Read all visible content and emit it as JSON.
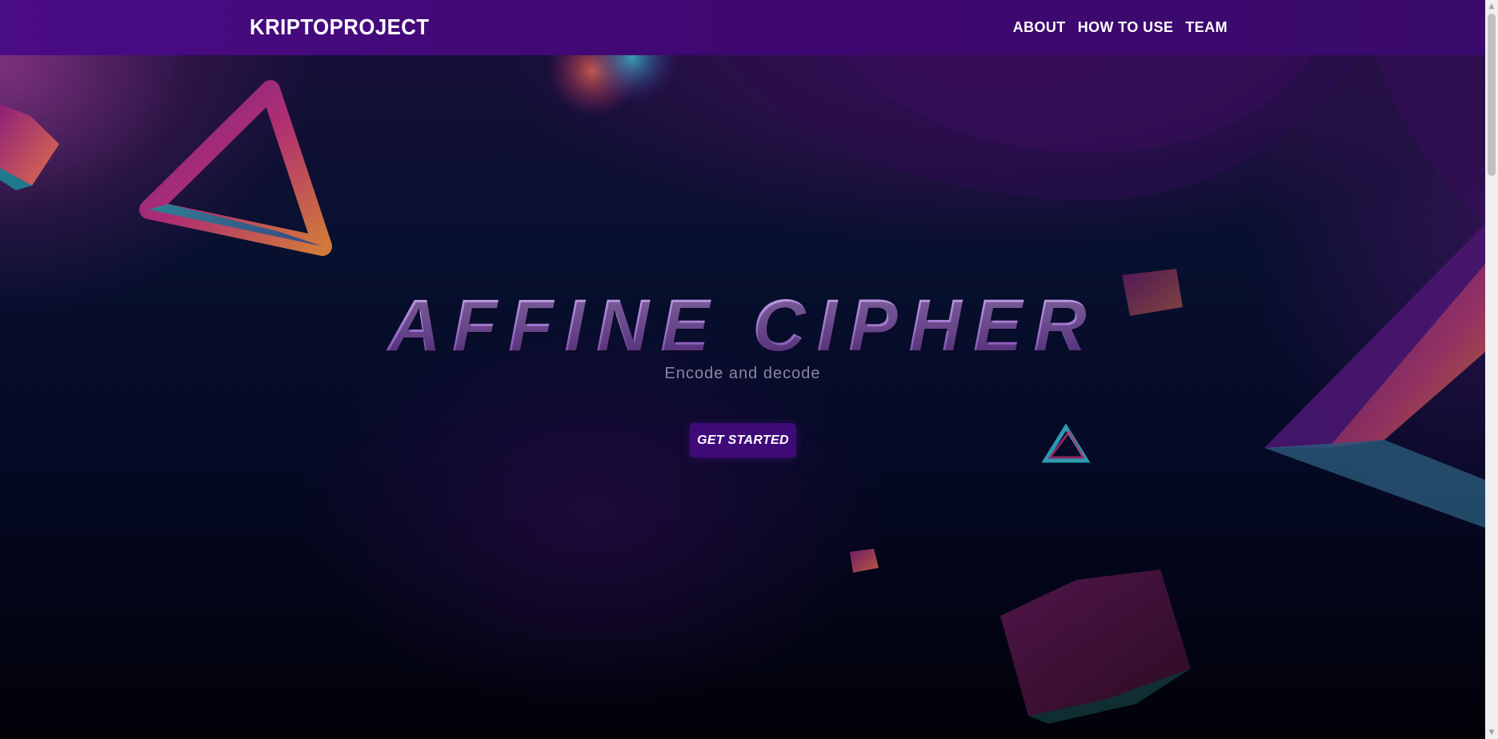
{
  "navbar": {
    "brand": "KRIPTOPROJECT",
    "links": [
      {
        "label": "ABOUT"
      },
      {
        "label": "HOW TO USE"
      },
      {
        "label": "TEAM"
      }
    ]
  },
  "hero": {
    "title": "AFFINE CIPHER",
    "subtitle": "Encode and decode",
    "cta_label": "GET STARTED"
  },
  "colors": {
    "navbar": "#3f0870",
    "accent": "#3f0a78",
    "title": "#b48fd6"
  },
  "decorations": [
    {
      "icon": "triangle-shape"
    },
    {
      "icon": "cube-shape"
    },
    {
      "icon": "sphere-shape"
    }
  ]
}
